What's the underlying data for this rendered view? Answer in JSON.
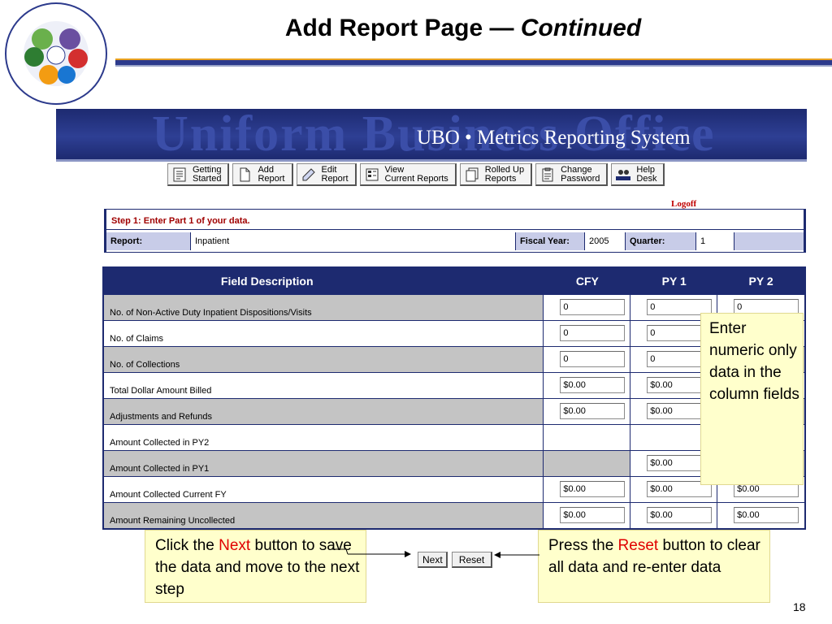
{
  "slide": {
    "title_main": "Add Report Page — ",
    "title_italic": "Continued",
    "page_number": "18"
  },
  "banner": {
    "watermark": "Uniform Business Office",
    "title": "UBO • Metrics Reporting System"
  },
  "nav": [
    {
      "label": "Getting\nStarted",
      "icon": "document-list-icon"
    },
    {
      "label": "Add\nReport",
      "icon": "blank-page-icon"
    },
    {
      "label": "Edit\nReport",
      "icon": "pencil-icon"
    },
    {
      "label": "View\nCurrent Reports",
      "icon": "report-grid-icon"
    },
    {
      "label": "Rolled Up\nReports",
      "icon": "stacked-pages-icon"
    },
    {
      "label": "Change\nPassword",
      "icon": "clipboard-icon"
    },
    {
      "label": "Help\nDesk",
      "icon": "help-desk-icon"
    }
  ],
  "logoff": "Logoff",
  "step": {
    "heading": "Step 1: Enter Part 1 of your data.",
    "report_label": "Report:",
    "report_value": "Inpatient",
    "fiscal_year_label": "Fiscal Year:",
    "fiscal_year_value": "2005",
    "quarter_label": "Quarter:",
    "quarter_value": "1"
  },
  "table": {
    "headers": [
      "Field Description",
      "CFY",
      "PY 1",
      "PY 2"
    ],
    "rows": [
      {
        "desc": "No. of Non-Active Duty Inpatient Dispositions/Visits",
        "cfy": "0",
        "py1": "0",
        "py2": "0"
      },
      {
        "desc": "No. of Claims",
        "cfy": "0",
        "py1": "0",
        "py2": ""
      },
      {
        "desc": "No. of Collections",
        "cfy": "0",
        "py1": "0",
        "py2": ""
      },
      {
        "desc": "Total Dollar Amount Billed",
        "cfy": "$0.00",
        "py1": "$0.00",
        "py2": ""
      },
      {
        "desc": "Adjustments and Refunds",
        "cfy": "$0.00",
        "py1": "$0.00",
        "py2": ""
      },
      {
        "desc": "Amount Collected in PY2",
        "cfy": "",
        "py1": "",
        "py2": ""
      },
      {
        "desc": "Amount Collected in PY1",
        "cfy": "",
        "py1": "$0.00",
        "py2": ""
      },
      {
        "desc": "Amount Collected Current FY",
        "cfy": "$0.00",
        "py1": "$0.00",
        "py2": "$0.00"
      },
      {
        "desc": "Amount Remaining Uncollected",
        "cfy": "$0.00",
        "py1": "$0.00",
        "py2": "$0.00"
      }
    ]
  },
  "callouts": {
    "numeric": "Enter numeric only data in the column fields",
    "next_pre": "Click the ",
    "next_key": "Next",
    "next_post": " button to save the data and move to the next step",
    "reset_pre": "Press the ",
    "reset_key": "Reset",
    "reset_post": " button to clear all data and re-enter data"
  },
  "buttons": {
    "next": "Next",
    "reset": "Reset"
  },
  "colors": {
    "navy": "#1d2a70",
    "callout_bg": "#ffffcc",
    "highlight_red": "#e00000",
    "row_grey": "#c4c4c4"
  }
}
